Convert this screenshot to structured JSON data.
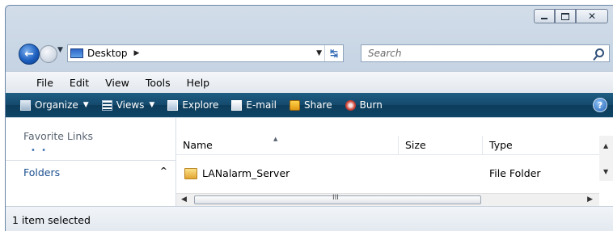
{
  "window": {
    "caption_buttons": [
      "minimize",
      "maximize",
      "close"
    ]
  },
  "navigation": {
    "address": {
      "location": "Desktop"
    },
    "search": {
      "placeholder": "Search"
    }
  },
  "menu": {
    "items": [
      "File",
      "Edit",
      "View",
      "Tools",
      "Help"
    ]
  },
  "toolbar": {
    "organize": "Organize",
    "views": "Views",
    "explore": "Explore",
    "email": "E-mail",
    "share": "Share",
    "burn": "Burn",
    "help_glyph": "?"
  },
  "nav_pane": {
    "favorite_links": "Favorite Links",
    "folders": "Folders"
  },
  "file_list": {
    "columns": {
      "name": "Name",
      "size": "Size",
      "type": "Type"
    },
    "rows": [
      {
        "name": "LANalarm_Server",
        "size": "",
        "type": "File Folder"
      }
    ]
  },
  "status": {
    "text": "1 item selected"
  },
  "colors": {
    "toolbar": "#144a6d",
    "accent": "#1b4f8f"
  }
}
